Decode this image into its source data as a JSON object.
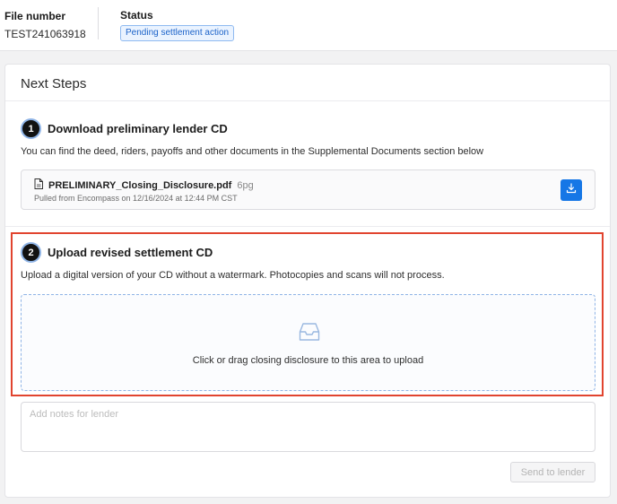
{
  "header": {
    "file_number_label": "File number",
    "file_number_value": "TEST241063918",
    "status_label": "Status",
    "status_badge": "Pending settlement action"
  },
  "card": {
    "title": "Next Steps",
    "step1": {
      "number": "1",
      "title": "Download preliminary lender CD",
      "description": "You can find the deed, riders, payoffs and other documents in the Supplemental Documents section below",
      "file": {
        "name": "PRELIMINARY_Closing_Disclosure.pdf",
        "pages": "6pg",
        "meta": "Pulled from Encompass on 12/16/2024 at 12:44 PM CST",
        "icon": "file-icon",
        "download_icon": "download-icon"
      }
    },
    "step2": {
      "number": "2",
      "title": "Upload revised settlement CD",
      "description": "Upload a digital version of your CD without a watermark. Photocopies and scans will not process.",
      "dropzone_text": "Click or drag closing disclosure to this area to upload",
      "dropzone_icon": "inbox-icon"
    },
    "notes_placeholder": "Add notes for lender",
    "send_button": "Send to lender"
  },
  "colors": {
    "accent": "#1677e6",
    "highlight": "#e1442f",
    "badge_text": "#1c63c9",
    "badge_bg": "#eaf3ff"
  }
}
